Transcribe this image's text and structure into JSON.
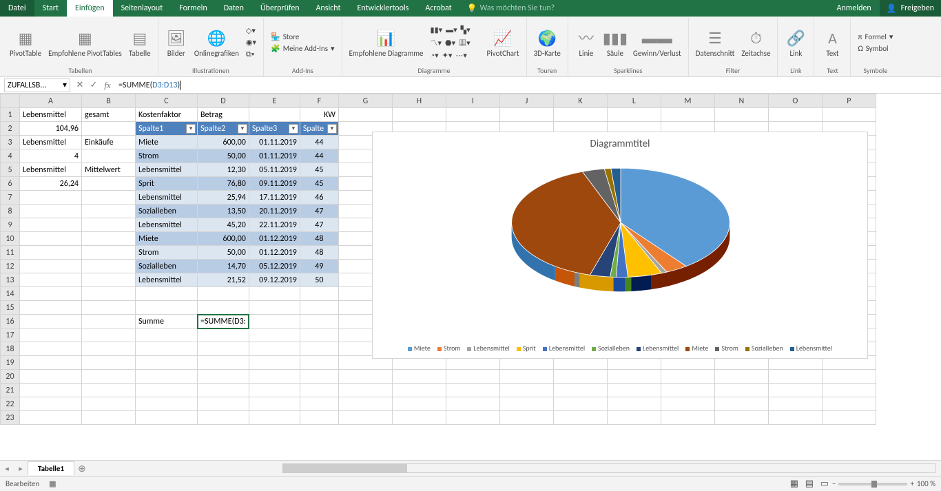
{
  "titlebar": {
    "file": "Datei",
    "start": "Start",
    "insert": "Einfügen",
    "layout": "Seitenlayout",
    "formulas": "Formeln",
    "data": "Daten",
    "review": "Überprüfen",
    "view": "Ansicht",
    "dev": "Entwicklertools",
    "acrobat": "Acrobat",
    "tell_me": "Was möchten Sie tun?",
    "signin": "Anmelden",
    "share": "Freigeben"
  },
  "ribbon": {
    "tables": {
      "group": "Tabellen",
      "pivot": "PivotTable",
      "recommended": "Empfohlene PivotTables",
      "table": "Tabelle"
    },
    "illus": {
      "group": "Illustrationen",
      "pics": "Bilder",
      "online": "Onlinegrafiken"
    },
    "addins": {
      "group": "Add-Ins",
      "store": "Store",
      "my": "Meine Add-Ins"
    },
    "charts": {
      "group": "Diagramme",
      "recommended": "Empfohlene Diagramme",
      "pivotchart": "PivotChart"
    },
    "tours": {
      "group": "Touren",
      "map3d": "3D-Karte"
    },
    "sparks": {
      "group": "Sparklines",
      "line": "Linie",
      "col": "Säule",
      "winloss": "Gewinn/Verlust"
    },
    "filter": {
      "group": "Filter",
      "slicer": "Datenschnitt",
      "timeline": "Zeitachse"
    },
    "link": {
      "group": "Link",
      "link": "Link"
    },
    "text": {
      "group": "Text",
      "text": "Text"
    },
    "symbols": {
      "group": "Symbole",
      "formula": "Formel",
      "symbol": "Symbol"
    }
  },
  "fx": {
    "namebox": "ZUFALLSB...",
    "formula_prefix": "=SUMME(",
    "formula_ref": "D3:D13",
    "formula_suffix": ")"
  },
  "cols": [
    "A",
    "B",
    "C",
    "D",
    "E",
    "F",
    "G",
    "H",
    "I",
    "J",
    "K",
    "L",
    "M",
    "N",
    "O",
    "P"
  ],
  "rows": [
    1,
    2,
    3,
    4,
    5,
    6,
    7,
    8,
    9,
    10,
    11,
    12,
    13,
    14,
    15,
    16,
    17,
    18,
    19,
    20,
    21,
    22,
    23
  ],
  "cells": {
    "A1": "Lebensmittel",
    "B1": "gesamt",
    "C1": "Kostenfaktor",
    "D1": "Betrag",
    "F1": "KW",
    "A2": "104,96",
    "A3": "Lebensmittel",
    "B3": "Einkäufe",
    "A4": "4",
    "A5": "Lebensmittel",
    "B5": "Mittelwert",
    "A6": "26,24",
    "C16": "Summe",
    "D16": "=SUMME(D3:"
  },
  "tableHeaders": [
    "Spalte1",
    "Spalte2",
    "Spalte3",
    "Spalte"
  ],
  "tableRows": [
    {
      "c": "Miete",
      "d": "600,00",
      "e": "01.11.2019",
      "f": "44"
    },
    {
      "c": "Strom",
      "d": "50,00",
      "e": "01.11.2019",
      "f": "44"
    },
    {
      "c": "Lebensmittel",
      "d": "12,30",
      "e": "05.11.2019",
      "f": "45"
    },
    {
      "c": "Sprit",
      "d": "76,80",
      "e": "09.11.2019",
      "f": "45"
    },
    {
      "c": "Lebensmittel",
      "d": "25,94",
      "e": "17.11.2019",
      "f": "46"
    },
    {
      "c": "Sozialleben",
      "d": "13,50",
      "e": "20.11.2019",
      "f": "47"
    },
    {
      "c": "Lebensmittel",
      "d": "45,20",
      "e": "22.11.2019",
      "f": "47"
    },
    {
      "c": "Miete",
      "d": "600,00",
      "e": "01.12.2019",
      "f": "48"
    },
    {
      "c": "Strom",
      "d": "50,00",
      "e": "01.12.2019",
      "f": "48"
    },
    {
      "c": "Sozialleben",
      "d": "14,70",
      "e": "05.12.2019",
      "f": "49"
    },
    {
      "c": "Lebensmittel",
      "d": "21,52",
      "e": "09.12.2019",
      "f": "50"
    }
  ],
  "chart_data": {
    "type": "pie",
    "title": "Diagrammtitel",
    "categories": [
      "Miete",
      "Strom",
      "Lebensmittel",
      "Sprit",
      "Lebensmittel",
      "Sozialleben",
      "Lebensmittel",
      "Miete",
      "Strom",
      "Sozialleben",
      "Lebensmittel"
    ],
    "values": [
      600.0,
      50.0,
      12.3,
      76.8,
      25.94,
      13.5,
      45.2,
      600.0,
      50.0,
      14.7,
      21.52
    ],
    "colors": [
      "#5b9bd5",
      "#ed7d31",
      "#a5a5a5",
      "#ffc000",
      "#4472c4",
      "#70ad47",
      "#264478",
      "#9e480e",
      "#636363",
      "#997300",
      "#255e91"
    ]
  },
  "sheet": {
    "tab": "Tabelle1"
  },
  "status": {
    "mode": "Bearbeiten",
    "zoom": "100 %"
  }
}
